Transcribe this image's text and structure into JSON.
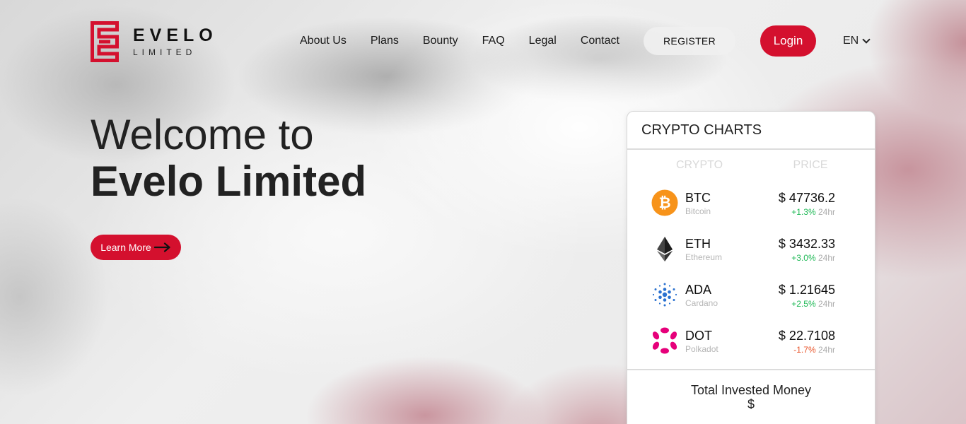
{
  "brand": {
    "name": "EVELO",
    "sub": "LIMITED",
    "accent": "#d4102e"
  },
  "nav": {
    "items": [
      "About Us",
      "Plans",
      "Bounty",
      "FAQ",
      "Legal",
      "Contact"
    ]
  },
  "header": {
    "register_label": "REGISTER",
    "login_label": "Login",
    "language": "EN"
  },
  "hero": {
    "line1": "Welcome to",
    "line2": "Evelo Limited",
    "cta_label": "Learn More"
  },
  "crypto_card": {
    "title": "CRYPTO CHARTS",
    "col_crypto": "CRYPTO",
    "col_price": "PRICE",
    "coins": [
      {
        "symbol": "BTC",
        "name": "Bitcoin",
        "price": "$ 47736.2",
        "change": "+1.3%",
        "period": "24hr",
        "icon": "bitcoin-icon",
        "color": "#f7931a"
      },
      {
        "symbol": "ETH",
        "name": "Ethereum",
        "price": "$ 3432.33",
        "change": "+3.0%",
        "period": "24hr",
        "icon": "ethereum-icon",
        "color": "#343434"
      },
      {
        "symbol": "ADA",
        "name": "Cardano",
        "price": "$ 1.21645",
        "change": "+2.5%",
        "period": "24hr",
        "icon": "cardano-icon",
        "color": "#2a71d0"
      },
      {
        "symbol": "DOT",
        "name": "Polkadot",
        "price": "$ 22.7108",
        "change": "-1.7%",
        "period": "24hr",
        "icon": "polkadot-icon",
        "color": "#e6007a"
      }
    ],
    "footer_label": "Total Invested Money",
    "footer_value": "$"
  }
}
